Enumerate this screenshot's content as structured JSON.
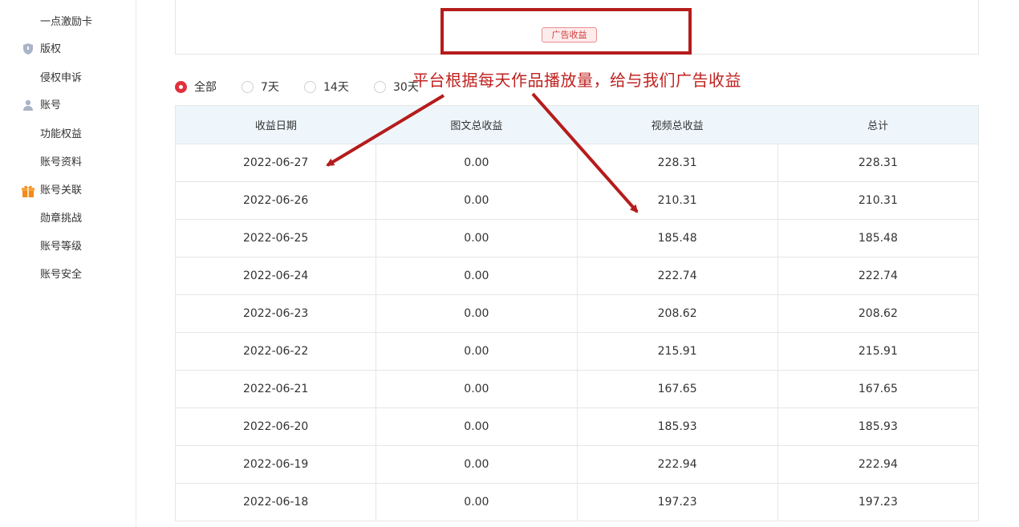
{
  "sidebar": {
    "items": [
      {
        "label": "一点激励卡",
        "icon": null
      },
      {
        "label": "版权",
        "icon": "shield-icon"
      },
      {
        "label": "侵权申诉",
        "icon": null
      },
      {
        "label": "账号",
        "icon": "user-icon"
      },
      {
        "label": "功能权益",
        "icon": null
      },
      {
        "label": "账号资料",
        "icon": null
      },
      {
        "label": "账号关联",
        "icon": "gift-icon"
      },
      {
        "label": "勋章挑战",
        "icon": null
      },
      {
        "label": "账号等级",
        "icon": null
      },
      {
        "label": "账号安全",
        "icon": null
      }
    ]
  },
  "top_card": {
    "badge_label": "广告收益"
  },
  "annotation": {
    "text": "平台根据每天作品播放量，给与我们广告收益",
    "color": "#c0211f"
  },
  "filter": {
    "options": [
      "全部",
      "7天",
      "14天",
      "30天"
    ],
    "selected": "全部"
  },
  "table": {
    "columns": [
      "收益日期",
      "图文总收益",
      "视频总收益",
      "总计"
    ],
    "rows": [
      [
        "2022-06-27",
        "0.00",
        "228.31",
        "228.31"
      ],
      [
        "2022-06-26",
        "0.00",
        "210.31",
        "210.31"
      ],
      [
        "2022-06-25",
        "0.00",
        "185.48",
        "185.48"
      ],
      [
        "2022-06-24",
        "0.00",
        "222.74",
        "222.74"
      ],
      [
        "2022-06-23",
        "0.00",
        "208.62",
        "208.62"
      ],
      [
        "2022-06-22",
        "0.00",
        "215.91",
        "215.91"
      ],
      [
        "2022-06-21",
        "0.00",
        "167.65",
        "167.65"
      ],
      [
        "2022-06-20",
        "0.00",
        "185.93",
        "185.93"
      ],
      [
        "2022-06-19",
        "0.00",
        "222.94",
        "222.94"
      ],
      [
        "2022-06-18",
        "0.00",
        "197.23",
        "197.23"
      ]
    ]
  },
  "colors": {
    "accent": "#e0313c",
    "header_bg": "#eef6fb",
    "annotation_red": "#b51c1c"
  }
}
